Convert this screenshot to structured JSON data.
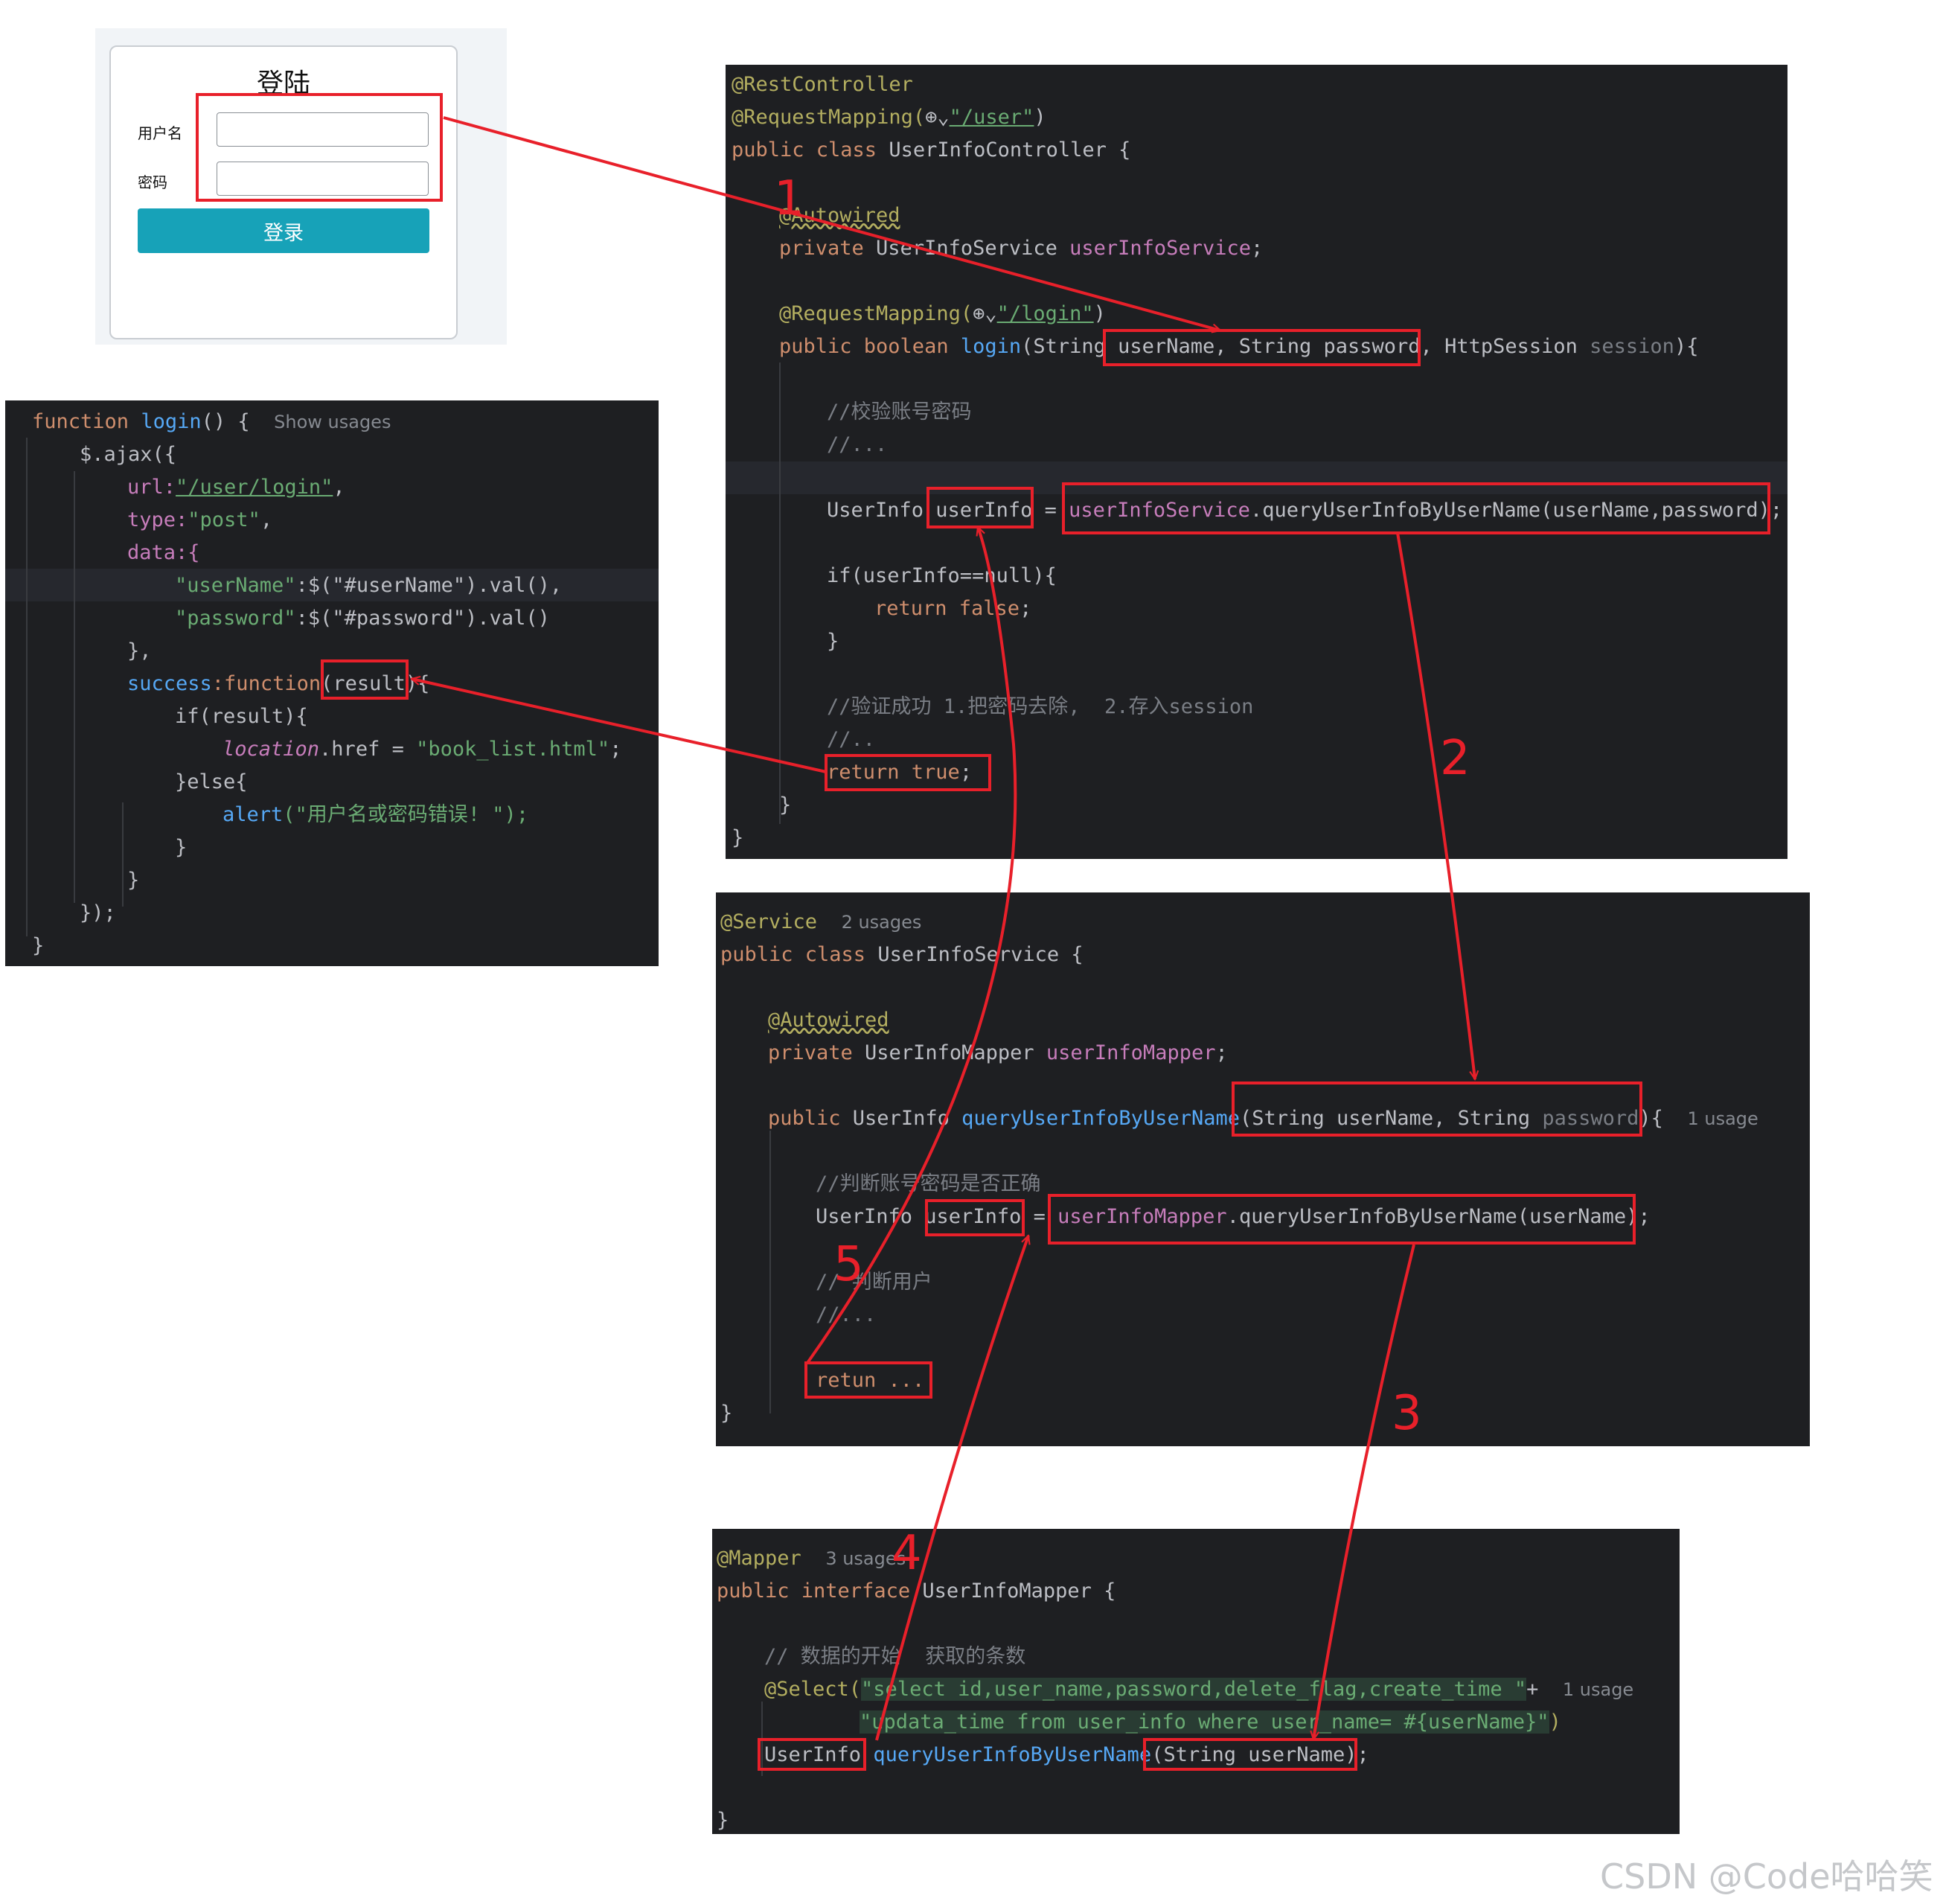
{
  "login_form": {
    "title": "登陆",
    "username_label": "用户名",
    "password_label": "密码",
    "username_value": "",
    "password_value": "",
    "submit_label": "登录"
  },
  "js_code": {
    "l1_kw": "function",
    "l1_name": "login",
    "l1_rest": "() {",
    "l1_hint": "Show usages",
    "l2": "$.ajax({",
    "l3_key": "url:",
    "l3_val": "\"/user/login\"",
    "l3_end": ",",
    "l4_key": "type:",
    "l4_val": "\"post\"",
    "l4_end": ",",
    "l5": "data:{",
    "l6_key": "\"userName\"",
    "l6_rest": ":$(\"#userName\").val(),",
    "l7_key": "\"password\"",
    "l7_rest": ":$(\"#password\").val()",
    "l8": "},",
    "l9_key": "success",
    "l9_kw": ":function",
    "l9_rest": "(result){",
    "l10": "if(result){",
    "l11_loc": "location",
    "l11_rest": ".href = ",
    "l11_val": "\"book_list.html\"",
    "l11_end": ";",
    "l12": "}else{",
    "l13_fn": "alert",
    "l13_val": "(\"用户名或密码错误! \");",
    "l14": "}",
    "l15": "}",
    "l16": "});",
    "l17": "}"
  },
  "controller_code": {
    "l1": "@RestController",
    "l2_ann": "@RequestMapping(",
    "l2_icon": "⊕⌄",
    "l2_val": "\"/user\"",
    "l2_end": ")",
    "l3_kw": "public class ",
    "l3_rest": "UserInfoController {",
    "l4": "@Autowired",
    "l5_kw": "private ",
    "l5_type": "UserInfoService ",
    "l5_field": "userInfoService",
    "l5_end": ";",
    "l6_ann": "@RequestMapping(",
    "l6_icon": "⊕⌄",
    "l6_val": "\"/login\"",
    "l6_end": ")",
    "l7_kw": "public boolean ",
    "l7_fn": "login",
    "l7_rest": "(String userName, String password, HttpSession ",
    "l7_dim": "session",
    "l7_end": "){",
    "l8": "//校验账号密码",
    "l9": "//...",
    "l10_a": "UserInfo userInfo = ",
    "l10_field": "userInfoService",
    "l10_b": ".queryUserInfoByUserName(userName,password);",
    "l11": "if(userInfo==null){",
    "l12_kw": "return false",
    "l12_end": ";",
    "l13": "}",
    "l14": "//验证成功 1.把密码去除,  2.存入session",
    "l15": "//..",
    "l16_kw": "return true",
    "l16_end": ";",
    "l17": "}",
    "l18": "}"
  },
  "service_code": {
    "l1": "@Service",
    "l1_hint": "2 usages",
    "l2_kw": "public class ",
    "l2_rest": "UserInfoService {",
    "l3": "@Autowired",
    "l4_kw": "private ",
    "l4_type": "UserInfoMapper ",
    "l4_field": "userInfoMapper",
    "l4_end": ";",
    "l5_kw": "public ",
    "l5_type": "UserInfo ",
    "l5_fn": "queryUserInfoByUserName",
    "l5_rest": "(String userName, String ",
    "l5_dim": "password",
    "l5_end": "){",
    "l5_hint": "1 usage",
    "l6": "//判断账号密码是否正确",
    "l7_a": "UserInfo userInfo = ",
    "l7_field": "userInfoMapper",
    "l7_b": ".queryUserInfoByUserName(userName);",
    "l8": "// 判断用户",
    "l9": "//...",
    "l10": "retun ...",
    "l11": "}"
  },
  "mapper_code": {
    "l1": "@Mapper",
    "l1_hint": "3 usages",
    "l2_kw": "public interface ",
    "l2_rest": "UserInfoMapper {",
    "l3": "// 数据的开始  获取的条数",
    "l4_ann": "@Select(",
    "l4_val": "\"select id,user_name,password,delete_flag,create_time \"",
    "l4_end": "+",
    "l4_hint": "1 usage",
    "l5_val": "\"updata_time from user_info where user_name= #{userName}\"",
    "l5_end": ")",
    "l6_type": "UserInfo ",
    "l6_fn": "queryUserInfoByUserName",
    "l6_rest": "(String userName);",
    "l7": "}"
  },
  "step_labels": [
    "1",
    "2",
    "3",
    "4",
    "5"
  ],
  "annotation_color": "#e8202a",
  "watermark": "CSDN @Code哈哈笑"
}
